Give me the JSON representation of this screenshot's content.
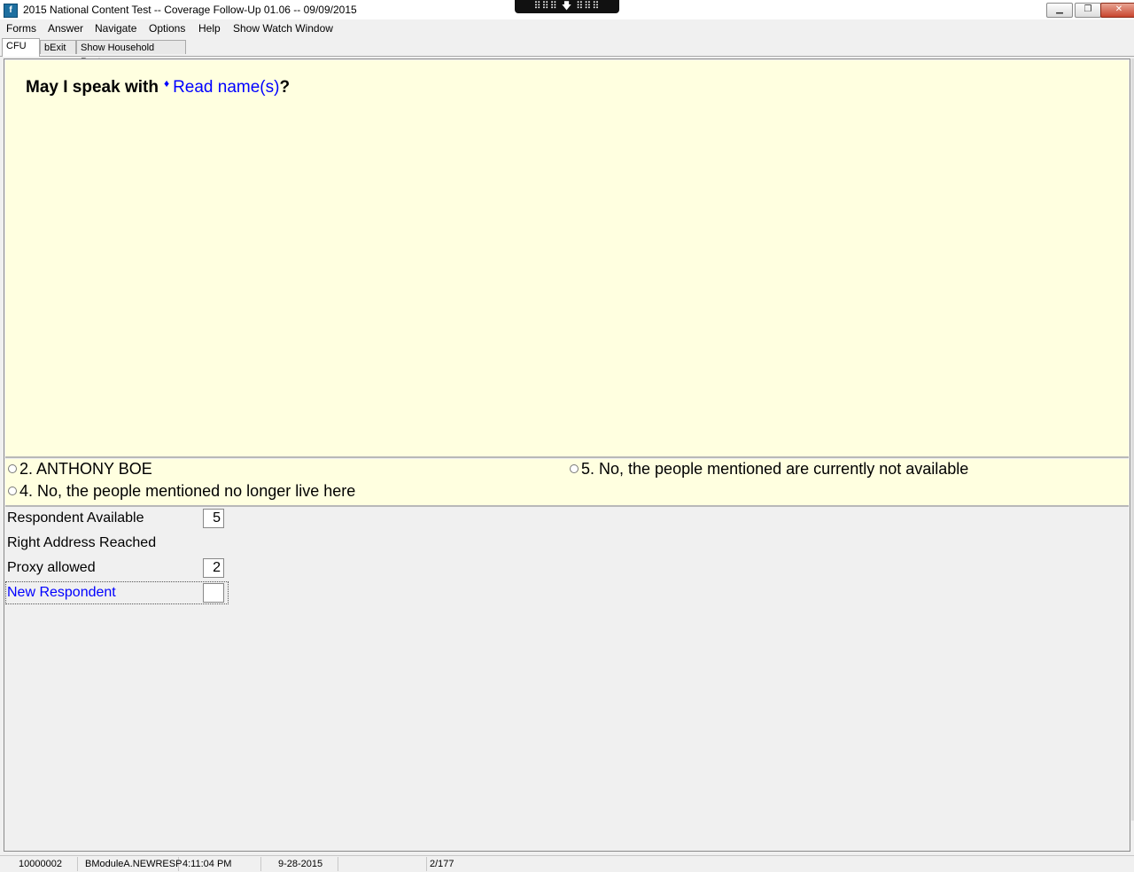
{
  "window": {
    "title": "2015 National Content Test -- Coverage Follow-Up 01.06 -- 09/09/2015",
    "remote_bar": "⠿⠿⠿ 🡇 ⠿⠿⠿"
  },
  "menu": {
    "forms": "Forms",
    "answer": "Answer",
    "navigate": "Navigate",
    "options": "Options",
    "help": "Help",
    "watch": "Show Watch Window"
  },
  "tabs": {
    "cfu": "CFU",
    "bexit": "bExit",
    "roster": "Show Household Roster"
  },
  "question": {
    "prefix": "May I speak with",
    "marker": "♦",
    "fill": "Read name(s)",
    "suffix": "?"
  },
  "options": {
    "opt2": "2. ANTHONY BOE",
    "opt5": "5. No, the people mentioned are currently not available",
    "opt4": "4. No, the people mentioned no longer live here"
  },
  "fields": {
    "respondent_available": {
      "label": "Respondent Available",
      "value": "5"
    },
    "right_address": {
      "label": "Right Address Reached"
    },
    "proxy_allowed": {
      "label": "Proxy allowed",
      "value": "2"
    },
    "new_respondent": {
      "label": "New Respondent",
      "value": ""
    }
  },
  "status": {
    "case_id": "10000002",
    "field_name": "BModuleA.NEWRESP",
    "time": "4:11:04 PM",
    "date": "9-28-2015",
    "page": "2/177"
  },
  "colors": {
    "question_bg": "#ffffe0",
    "fill_text": "#0000ff"
  }
}
